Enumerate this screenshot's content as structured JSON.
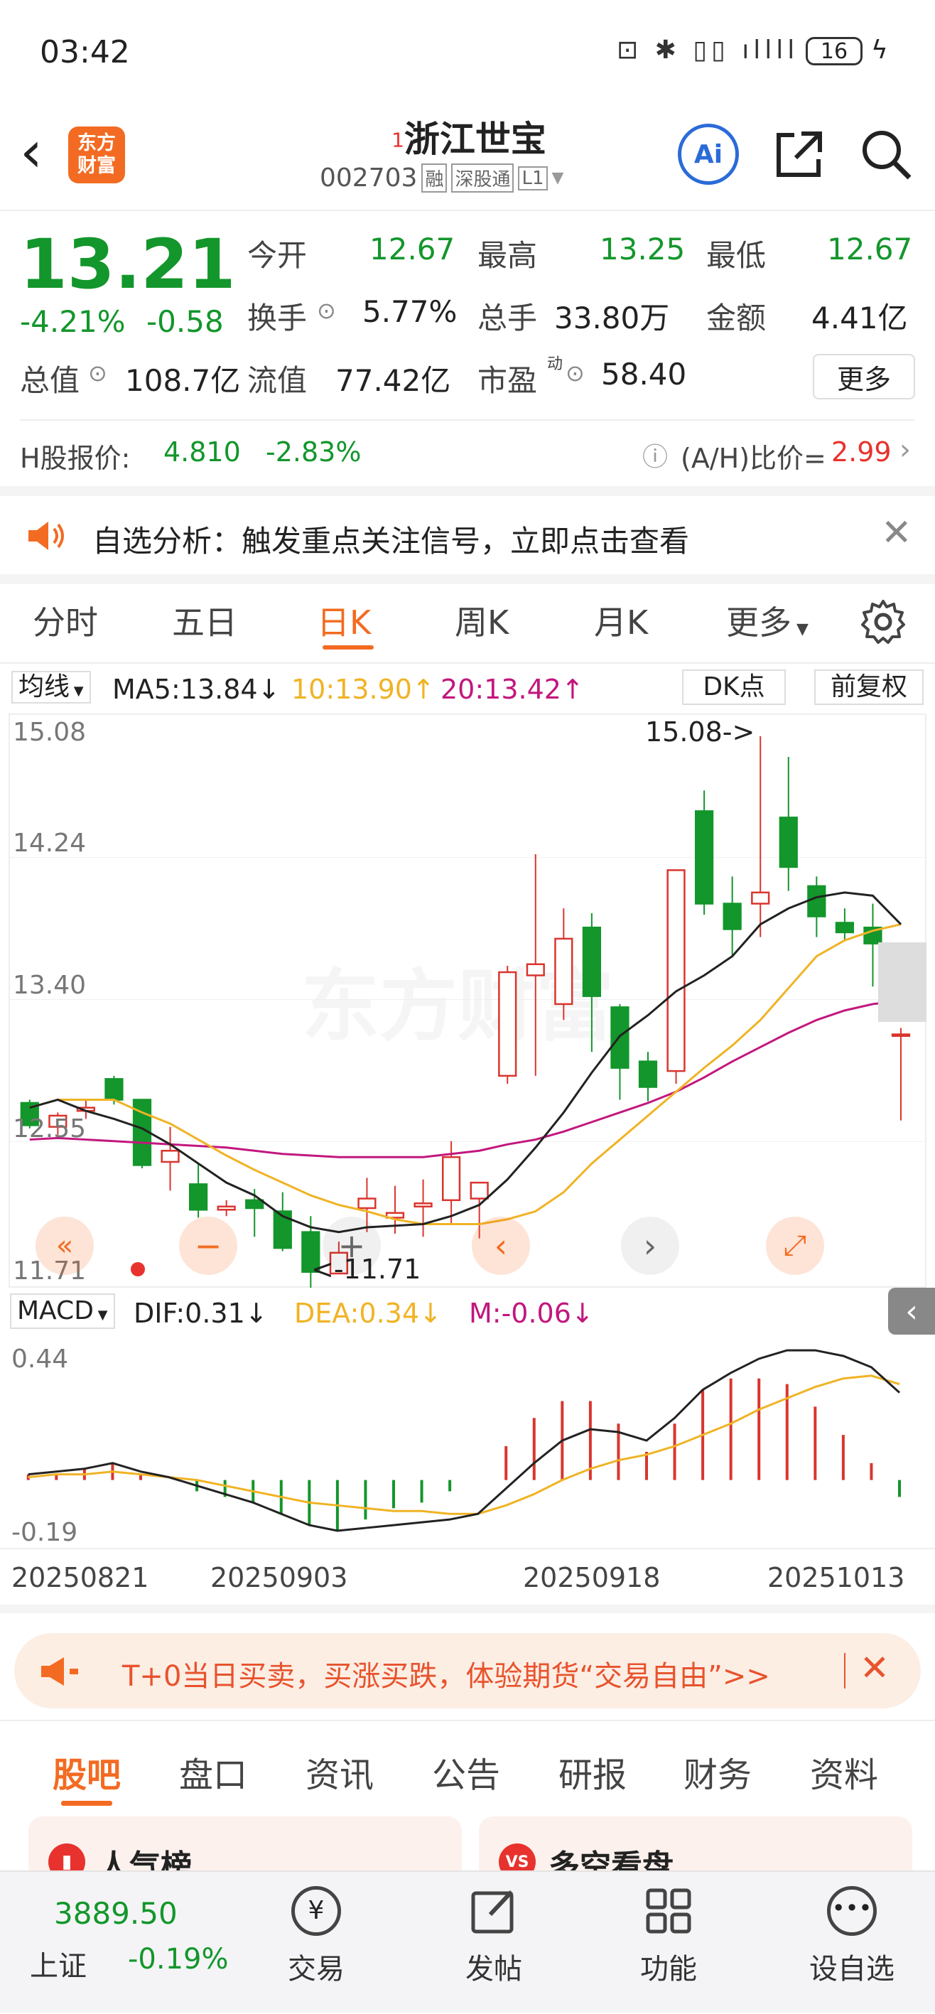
{
  "status": {
    "time": "03:42",
    "battery": "16"
  },
  "header": {
    "logo_line1": "东方",
    "logo_line2": "财富",
    "title_sup": "1",
    "title": "浙江世宝",
    "code": "002703",
    "tags": [
      "融",
      "深股通",
      "L1"
    ],
    "ai": "Ai"
  },
  "quote": {
    "price": "13.21",
    "pct": "-4.21%",
    "chg": "-0.58",
    "open_label": "今开",
    "open": "12.67",
    "high_label": "最高",
    "high": "13.25",
    "low_label": "最低",
    "low": "12.67",
    "turn_label": "换手",
    "turn": "5.77%",
    "vol_label": "总手",
    "vol": "33.80万",
    "amt_label": "金额",
    "amt": "4.41亿",
    "mcap_label": "总值",
    "mcap": "108.7亿",
    "fcap_label": "流值",
    "fcap": "77.42亿",
    "pe_label": "市盈",
    "pe_sup": "动",
    "pe": "58.40",
    "more": "更多"
  },
  "hshare": {
    "label": "H股报价:",
    "price": "4.810",
    "pct": "-2.83%",
    "ratio_label": "(A/H)比价=",
    "ratio": "2.99"
  },
  "alert": {
    "text": "自选分析：触发重点关注信号，立即点击查看"
  },
  "tabs": [
    {
      "label": "分时"
    },
    {
      "label": "五日"
    },
    {
      "label": "日K",
      "active": true
    },
    {
      "label": "周K"
    },
    {
      "label": "月K"
    },
    {
      "label": "更多"
    }
  ],
  "ma": {
    "select": "均线",
    "ma5": "MA5:13.84↓",
    "ma10": "10:13.90↑",
    "ma20": "20:13.42↑",
    "dk": "DK点",
    "fq": "前复权"
  },
  "kchart": {
    "y_labels": [
      "15.08",
      "14.24",
      "13.40",
      "12.55",
      "11.71"
    ],
    "max_note": "15.08->",
    "min_note": "<-11.71"
  },
  "macd": {
    "select": "MACD",
    "dif": "DIF:0.31↓",
    "dea": "DEA:0.34↓",
    "m": "M:-0.06↓",
    "y_top": "0.44",
    "y_bot": "-0.19"
  },
  "dates": [
    "20250821",
    "20250903",
    "20250918",
    "20251013"
  ],
  "ad": {
    "text": "T+0当日买卖，买涨买跌，体验期货“交易自由”>>"
  },
  "section_tabs": [
    {
      "label": "股吧",
      "active": true
    },
    {
      "label": "盘口"
    },
    {
      "label": "资讯"
    },
    {
      "label": "公告"
    },
    {
      "label": "研报"
    },
    {
      "label": "财务"
    },
    {
      "label": "资料"
    }
  ],
  "cards": [
    {
      "title": "人气榜"
    },
    {
      "title": "多空看盘"
    }
  ],
  "bottom": {
    "index_value": "3889.50",
    "index_name": "上证",
    "index_pct": "-0.19%",
    "items": [
      {
        "label": "交易"
      },
      {
        "label": "发帖"
      },
      {
        "label": "功能"
      },
      {
        "label": "设自选"
      }
    ]
  },
  "chart_data": {
    "type": "candlestick",
    "ohlc": [
      [
        12.78,
        12.64,
        12.8,
        12.62
      ],
      [
        12.63,
        12.7,
        12.72,
        12.58
      ],
      [
        12.73,
        12.75,
        12.8,
        12.68
      ],
      [
        12.93,
        12.8,
        12.95,
        12.77
      ],
      [
        12.8,
        12.39,
        12.8,
        12.37
      ],
      [
        12.41,
        12.48,
        12.63,
        12.23
      ],
      [
        12.27,
        12.11,
        12.4,
        12.06
      ],
      [
        12.11,
        12.13,
        12.17,
        12.07
      ],
      [
        12.17,
        12.12,
        12.24,
        11.94
      ],
      [
        12.1,
        11.87,
        12.22,
        11.85
      ],
      [
        11.97,
        11.72,
        12.07,
        11.6
      ],
      [
        11.71,
        11.84,
        11.91,
        11.71
      ],
      [
        12.12,
        12.18,
        12.31,
        11.97
      ],
      [
        12.06,
        12.09,
        12.26,
        11.96
      ],
      [
        12.13,
        12.15,
        12.3,
        11.94
      ],
      [
        12.17,
        12.44,
        12.54,
        12.02
      ],
      [
        12.18,
        12.28,
        12.25,
        11.93
      ],
      [
        12.95,
        13.6,
        13.64,
        12.9
      ],
      [
        13.58,
        13.65,
        14.34,
        12.95
      ],
      [
        13.4,
        13.81,
        14.0,
        13.3
      ],
      [
        13.88,
        13.45,
        13.97,
        13.1
      ],
      [
        13.38,
        13.0,
        13.4,
        12.8
      ],
      [
        13.04,
        12.88,
        13.1,
        12.79
      ],
      [
        12.98,
        14.24,
        14.24,
        12.9
      ],
      [
        14.61,
        14.03,
        14.74,
        13.96
      ],
      [
        14.03,
        13.87,
        14.2,
        13.7
      ],
      [
        14.03,
        14.1,
        15.08,
        13.82
      ],
      [
        14.57,
        14.26,
        14.95,
        14.11
      ],
      [
        14.14,
        13.95,
        14.2,
        13.82
      ],
      [
        13.91,
        13.85,
        14.0,
        13.8
      ],
      [
        13.88,
        13.78,
        14.03,
        13.51
      ],
      [
        13.2,
        13.21,
        13.25,
        12.67
      ]
    ],
    "ma5": [
      12.75,
      12.8,
      12.73,
      12.68,
      12.62,
      12.52,
      12.4,
      12.28,
      12.2,
      12.07,
      12.0,
      11.97,
      12.0,
      12.01,
      12.02,
      12.07,
      12.14,
      12.3,
      12.5,
      12.72,
      12.97,
      13.2,
      13.33,
      13.48,
      13.58,
      13.7,
      13.9,
      14.0,
      14.07,
      14.1,
      14.08,
      13.9
    ],
    "ma10": [
      12.75,
      12.8,
      12.8,
      12.8,
      12.72,
      12.65,
      12.55,
      12.45,
      12.36,
      12.28,
      12.2,
      12.14,
      12.1,
      12.05,
      12.02,
      12.02,
      12.02,
      12.05,
      12.1,
      12.22,
      12.4,
      12.55,
      12.7,
      12.85,
      13.0,
      13.14,
      13.3,
      13.5,
      13.7,
      13.8,
      13.86,
      13.9
    ],
    "ma20": [
      12.55,
      12.56,
      12.55,
      12.54,
      12.53,
      12.52,
      12.51,
      12.5,
      12.48,
      12.46,
      12.45,
      12.44,
      12.44,
      12.44,
      12.44,
      12.46,
      12.48,
      12.52,
      12.55,
      12.6,
      12.66,
      12.72,
      12.78,
      12.85,
      12.94,
      13.04,
      13.13,
      13.22,
      13.3,
      13.36,
      13.4,
      13.42
    ],
    "macd_dif": [
      0.02,
      0.03,
      0.04,
      0.06,
      0.03,
      0.01,
      -0.02,
      -0.05,
      -0.08,
      -0.12,
      -0.16,
      -0.18,
      -0.17,
      -0.16,
      -0.15,
      -0.14,
      -0.12,
      -0.03,
      0.06,
      0.14,
      0.18,
      0.17,
      0.14,
      0.22,
      0.32,
      0.38,
      0.43,
      0.46,
      0.46,
      0.44,
      0.4,
      0.31
    ],
    "macd_dea": [
      0.01,
      0.02,
      0.02,
      0.03,
      0.02,
      0.01,
      0.0,
      -0.02,
      -0.04,
      -0.06,
      -0.08,
      -0.09,
      -0.1,
      -0.11,
      -0.11,
      -0.12,
      -0.12,
      -0.09,
      -0.05,
      0.0,
      0.04,
      0.07,
      0.09,
      0.12,
      0.16,
      0.2,
      0.25,
      0.29,
      0.33,
      0.36,
      0.37,
      0.34
    ],
    "ylim": [
      11.71,
      15.08
    ]
  }
}
